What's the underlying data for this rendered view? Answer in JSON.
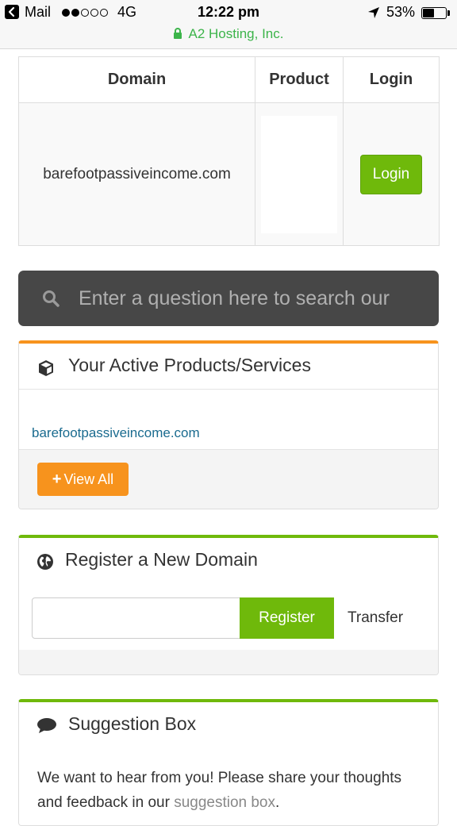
{
  "status_bar": {
    "back_app": "Mail",
    "signal_dots": [
      true,
      true,
      false,
      false,
      false
    ],
    "network": "4G",
    "time": "12:22 pm",
    "battery_pct": "53%",
    "battery_level": 0.53,
    "site_name": "A2 Hosting, Inc."
  },
  "domain_table": {
    "headers": [
      "Domain",
      "Product",
      "Login"
    ],
    "rows": [
      {
        "domain": "barefootpassiveincome.com",
        "login_label": "Login"
      }
    ]
  },
  "search": {
    "placeholder": "Enter a question here to search our"
  },
  "active_products": {
    "title": "Your Active Products/Services",
    "items": [
      "barefootpassiveincome.com"
    ],
    "view_all_label": "View All",
    "accent": "#f7931d"
  },
  "register_domain": {
    "title": "Register a New Domain",
    "register_label": "Register",
    "transfer_label": "Transfer",
    "accent": "#6fb90b"
  },
  "suggestion_box": {
    "title": "Suggestion Box",
    "text_before": "We want to hear from you! Please share your thoughts and feedback in our ",
    "link_text": "suggestion box",
    "text_after": "."
  },
  "colors": {
    "search_bg": "#474747",
    "green_button": "#6fb90b",
    "orange_button": "#f7931d",
    "link": "#1a6b8f",
    "secure_green": "#3cb44a"
  }
}
